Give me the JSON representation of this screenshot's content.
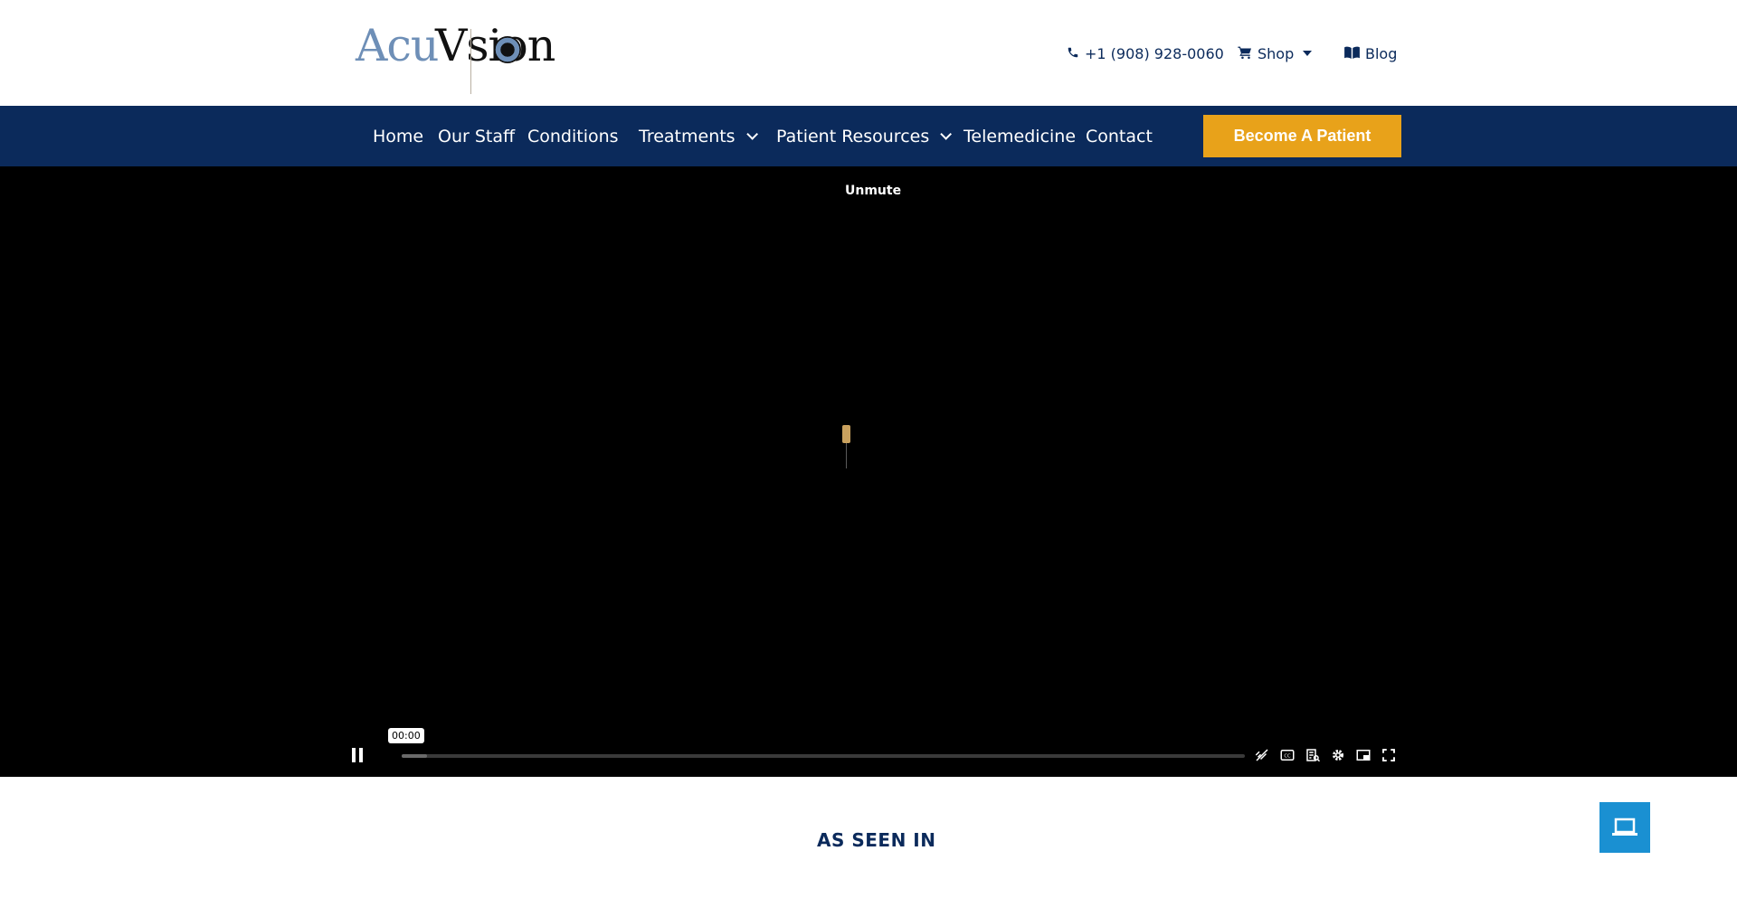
{
  "brand": {
    "part1": "Acu",
    "part2": "Vsion"
  },
  "topnav": {
    "phone": {
      "label": "+1 (908) 928-0060",
      "icon": "phone-icon"
    },
    "shop": {
      "label": "Shop",
      "icon": "cart-icon"
    },
    "blog": {
      "label": "Blog",
      "icon": "book-icon"
    }
  },
  "nav": {
    "items": [
      "Home",
      "Our Staff",
      "Conditions",
      "Treatments",
      "Patient Resources",
      "Telemedicine",
      "Contact"
    ],
    "cta": "Become A Patient"
  },
  "video": {
    "unmute_label": "Unmute",
    "time": "00:00",
    "progress_fraction": 0.03
  },
  "section": {
    "title": "AS SEEN IN"
  },
  "colors": {
    "navy": "#0b2a5b",
    "gold": "#e8a21a",
    "fab": "#1a90d2"
  }
}
